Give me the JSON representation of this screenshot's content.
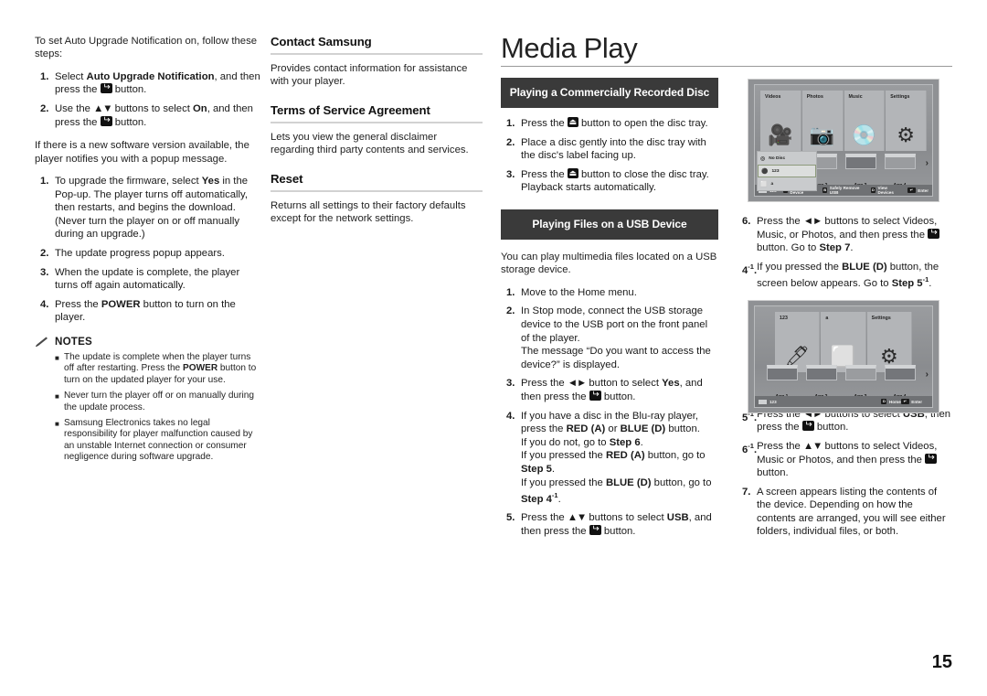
{
  "page_number": "15",
  "title": "Media Play",
  "column1": {
    "intro": "To set Auto Upgrade Notification on, follow these steps:",
    "steps": [
      {
        "num": "1.",
        "html": "Select <b>Auto Upgrade Notification</b>, and then press the <span class=\"kenter\"></span> button."
      },
      {
        "num": "2.",
        "html": "Use the <b class=\"arr\">▲▼</b> buttons to select <b>On</b>, and then press the <span class=\"kenter\"></span> button."
      }
    ],
    "mid_para": "If there is a new software version available, the player notifies you with a popup message.",
    "steps2": [
      {
        "num": "1.",
        "html": "To upgrade the firmware, select <b>Yes</b> in the Pop-up. The player turns off automatically, then restarts, and begins the download. (Never turn the player on or off manually during an upgrade.)"
      },
      {
        "num": "2.",
        "html": "The update progress popup appears."
      },
      {
        "num": "3.",
        "html": "When the update is complete, the player turns off again automatically."
      },
      {
        "num": "4.",
        "html": "Press the <b>POWER</b> button to turn on the player."
      }
    ],
    "notes_title": "NOTES",
    "notes": [
      "The update is complete when the player turns off after restarting. Press the <b>POWER</b> button to turn on the updated player for your use.",
      "Never turn the player off or on manually during the update process.",
      "Samsung Electronics takes no legal responsibility for player malfunction caused by an unstable Internet connection or consumer negligence during software upgrade."
    ]
  },
  "column2": {
    "sections": [
      {
        "heading": "Contact Samsung",
        "body": "Provides contact information for assistance with your player."
      },
      {
        "heading": "Terms of Service Agreement",
        "body": "Lets you view the general disclaimer regarding third party contents and services."
      },
      {
        "heading": "Reset",
        "body": "Returns all settings to their factory defaults except for the network settings."
      }
    ]
  },
  "column3": {
    "banner1": "Playing a Commercially Recorded Disc",
    "steps1": [
      {
        "num": "1.",
        "html": "Press the <span class=\"keject\"></span> button to open the disc tray."
      },
      {
        "num": "2.",
        "html": "Place a disc gently into the disc tray with the disc's label facing up."
      },
      {
        "num": "3.",
        "html": "Press the <span class=\"keject\"></span> button to close the disc tray. Playback starts automatically."
      }
    ],
    "banner2": "Playing Files on a USB Device",
    "intro": "You can play multimedia files located on a USB storage device.",
    "steps2": [
      {
        "num": "1.",
        "html": "Move to the Home menu."
      },
      {
        "num": "2.",
        "html": "In Stop mode, connect the USB storage device to the USB port on the front panel of the player.<br>The message “Do you want to access the device?” is displayed."
      },
      {
        "num": "3.",
        "html": "Press the <b class=\"arr\">◄►</b> button to select <b>Yes</b>, and then press the <span class=\"kenter\"></span> button."
      },
      {
        "num": "4.",
        "html": "If you have a disc in the Blu-ray player, press the <b>RED (A)</b> or <b>BLUE (D)</b> button.<br>If you do not, go to <b>Step 6</b>.<br>If you pressed the <b>RED (A)</b> button, go to <b>Step 5</b>.<br>If you pressed the <b>BLUE (D)</b> button, go to <b>Step 4<sup class=\"sm\">-1</sup></b>."
      },
      {
        "num": "5.",
        "html": "Press the <b class=\"arr\">▲▼</b> buttons to select <b>USB</b>, and then press the <span class=\"kenter\"></span> button."
      }
    ]
  },
  "column4": {
    "steps": [
      {
        "num": "6.",
        "html": "Press the <b class=\"arr\">◄►</b> buttons to select Videos, Music, or Photos, and then press the <span class=\"kenter\"></span> button. Go to <b>Step 7</b>."
      },
      {
        "num": "4<sup class=\"sm\">-1</sup>.",
        "html": "If you pressed the <b>BLUE (D)</b> button, the screen below appears. Go to <b>Step 5<sup class=\"sm\">-1</sup></b>."
      }
    ],
    "steps_after": [
      {
        "num": "5<sup class=\"sm\">-1</sup>.",
        "html": "Press the <b class=\"arr\">◄►</b> buttons to select <b>USB</b>, then press the <span class=\"kenter\"></span> button."
      },
      {
        "num": "6<sup class=\"sm\">-1</sup>.",
        "html": "Press the <b class=\"arr\">▲▼</b> buttons to select Videos, Music or Photos, and then press the <span class=\"kenter\"></span> button."
      },
      {
        "num": "7.",
        "html": "A screen appears listing the contents of the device. Depending on how the contents are arranged, you will see either folders, individual files, or both."
      }
    ]
  },
  "tv_screen_1": {
    "tiles": [
      {
        "label": "Videos",
        "icon": "video-camera-icon",
        "glyph": "🎥"
      },
      {
        "label": "Photos",
        "icon": "camera-icon",
        "glyph": "📷"
      },
      {
        "label": "Music",
        "icon": "music-disc-icon",
        "glyph": "💿"
      },
      {
        "label": "Settings",
        "icon": "gear-icon",
        "glyph": "⚙"
      }
    ],
    "device_panel": [
      {
        "label": "No Disc",
        "icon": "disc-icon",
        "glyph": "◎",
        "selected": false
      },
      {
        "label": "123",
        "icon": "usb-icon",
        "glyph": "⚫",
        "selected": true
      },
      {
        "label": "a",
        "icon": "folder-icon",
        "glyph": "⬜",
        "selected": false
      }
    ],
    "apps": [
      {
        "label": "App 1",
        "selected": false
      },
      {
        "label": "App 2",
        "selected": false
      },
      {
        "label": "App 3",
        "selected": true
      },
      {
        "label": "App 4",
        "selected": false
      }
    ],
    "bottom_bar": {
      "page": "123",
      "items": [
        {
          "key": "A",
          "label": "Change Device"
        },
        {
          "key": "B",
          "label": "Safely Remove USB"
        },
        {
          "key": "D",
          "label": "View Devices"
        }
      ],
      "enter": "Enter"
    }
  },
  "tv_screen_2": {
    "tiles": [
      {
        "label": "123",
        "icon": "usb-stick-icon",
        "glyph": "🖊"
      },
      {
        "label": "a",
        "icon": "folder-icon",
        "glyph": "⬜"
      },
      {
        "label": "Settings",
        "icon": "gear-icon",
        "glyph": "⚙"
      }
    ],
    "apps": [
      {
        "label": "App 1",
        "selected": true
      },
      {
        "label": "App 2",
        "selected": true
      },
      {
        "label": "App 3",
        "selected": false
      },
      {
        "label": "App 4",
        "selected": true
      }
    ],
    "bottom_bar": {
      "page": "123",
      "items": [
        {
          "key": "D",
          "label": "Home"
        }
      ],
      "enter": "Enter"
    }
  },
  "colors": {
    "banner_bg": "#3a3a3a",
    "rule": "#d2d2d2",
    "text": "#222222"
  }
}
